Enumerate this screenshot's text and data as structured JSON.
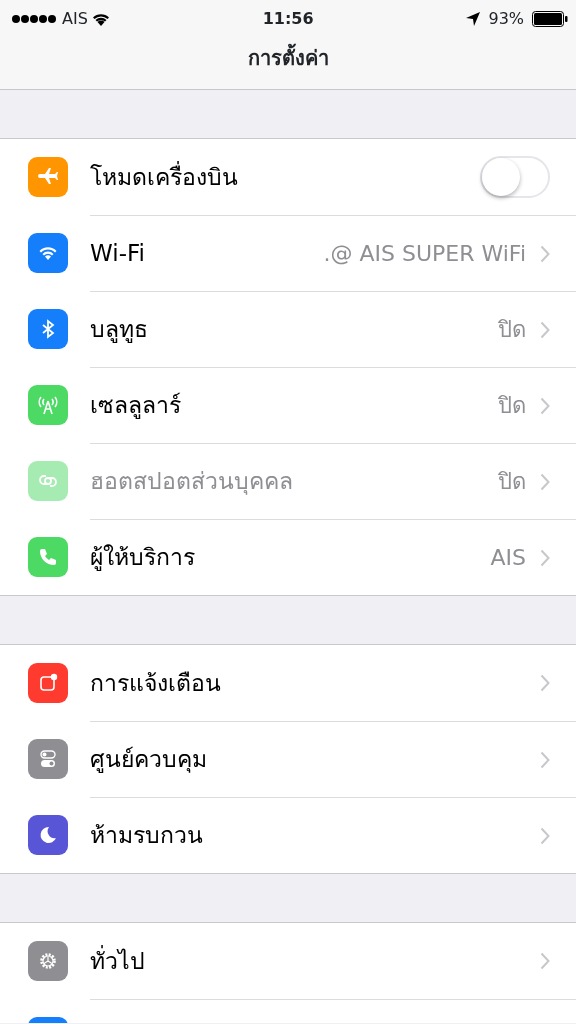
{
  "status_bar": {
    "carrier": "AIS",
    "time": "11:56",
    "battery": "93%"
  },
  "title": "การตั้งค่า",
  "groups": [
    {
      "items": [
        {
          "kind": "toggle",
          "label": "โหมดเครื่องบิน",
          "on": false,
          "color": "#ff9500",
          "disabled": false
        },
        {
          "kind": "link",
          "label": "Wi-Fi",
          "value": ".@ AIS SUPER WiFi",
          "color": "#147efb",
          "disabled": false
        },
        {
          "kind": "link",
          "label": "บลูทูธ",
          "value": "ปิด",
          "color": "#147efb",
          "disabled": false
        },
        {
          "kind": "link",
          "label": "เซลลูลาร์",
          "value": "ปิด",
          "color": "#4cd964",
          "disabled": false
        },
        {
          "kind": "link",
          "label": "ฮอตสปอตส่วนบุคคล",
          "value": "ปิด",
          "color": "#a6ecb2",
          "disabled": true
        },
        {
          "kind": "link",
          "label": "ผู้ให้บริการ",
          "value": "AIS",
          "color": "#4cd964",
          "disabled": false
        }
      ]
    },
    {
      "items": [
        {
          "kind": "link",
          "label": "การแจ้งเตือน",
          "color": "#ff3b30",
          "disabled": false
        },
        {
          "kind": "link",
          "label": "ศูนย์ควบคุม",
          "color": "#8e8e93",
          "disabled": false
        },
        {
          "kind": "link",
          "label": "ห้ามรบกวน",
          "color": "#5856d6",
          "disabled": false
        }
      ]
    },
    {
      "items": [
        {
          "kind": "link",
          "label": "ทั่วไป",
          "color": "#8e8e93",
          "disabled": false
        },
        {
          "kind": "cut",
          "color": "#147efb"
        }
      ]
    }
  ]
}
